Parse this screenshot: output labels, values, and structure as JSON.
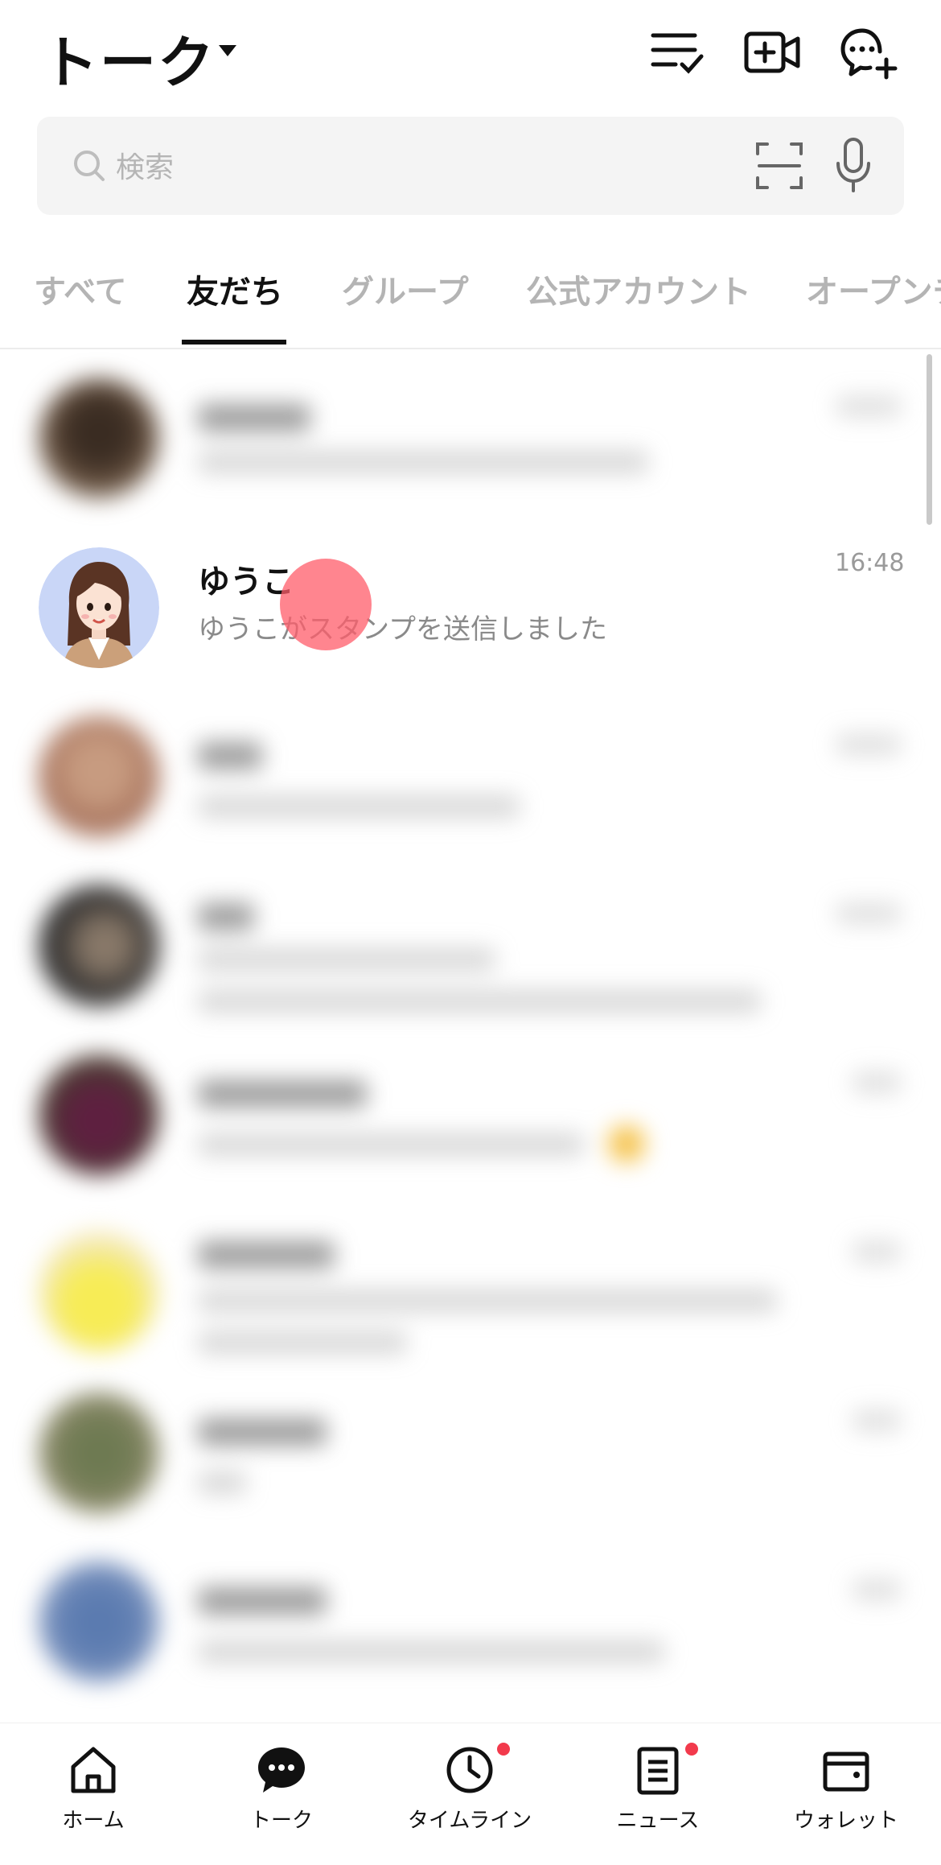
{
  "header": {
    "title": "トーク",
    "icons": [
      "edit-list-icon",
      "video-call-plus-icon",
      "new-chat-icon"
    ]
  },
  "search": {
    "placeholder": "検索",
    "icons": [
      "search-icon",
      "qr-scan-icon",
      "microphone-icon"
    ]
  },
  "tabs": [
    {
      "label": "すべて",
      "active": false
    },
    {
      "label": "友だち",
      "active": true
    },
    {
      "label": "グループ",
      "active": false
    },
    {
      "label": "公式アカウント",
      "active": false
    },
    {
      "label": "オープンチ",
      "active": false
    }
  ],
  "chats": [
    {
      "name": "ゆうこ",
      "message": "ゆうこがスタンプを送信しました",
      "time": "16:48",
      "blurred": false
    }
  ],
  "bottom_nav": [
    {
      "label": "ホーム",
      "icon": "home-icon",
      "badge": false
    },
    {
      "label": "トーク",
      "icon": "chat-bubble-icon",
      "badge": false,
      "active": true
    },
    {
      "label": "タイムライン",
      "icon": "clock-icon",
      "badge": true
    },
    {
      "label": "ニュース",
      "icon": "news-icon",
      "badge": true
    },
    {
      "label": "ウォレット",
      "icon": "wallet-icon",
      "badge": false
    }
  ],
  "colors": {
    "badge": "#f23a4c",
    "touch_indicator": "#ff5c6a",
    "avatar_background": "#c9d6f7"
  }
}
